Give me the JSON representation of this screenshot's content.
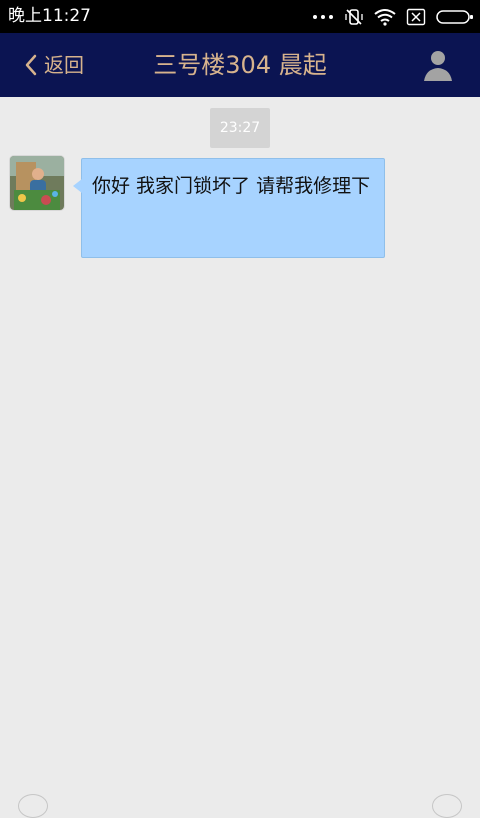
{
  "status_bar": {
    "time": "晚上11:27",
    "icons": [
      "more-icon",
      "vibrate-off-icon",
      "wifi-icon",
      "sim-card-icon",
      "battery-icon"
    ]
  },
  "header": {
    "back_label": "返回",
    "title": "三号楼304 晨起",
    "profile_icon": "user-profile-icon",
    "colors": {
      "background": "#0b1452",
      "text": "#d7b38d"
    }
  },
  "chat": {
    "timestamp": "23:27",
    "messages": [
      {
        "sender": "contact",
        "text": "你好 我家门锁坏了 请帮我修理下"
      }
    ],
    "colors": {
      "background": "#ebebeb",
      "incoming_bubble": "#a7d3ff",
      "timestamp_bg": "#d4d4d4"
    }
  }
}
